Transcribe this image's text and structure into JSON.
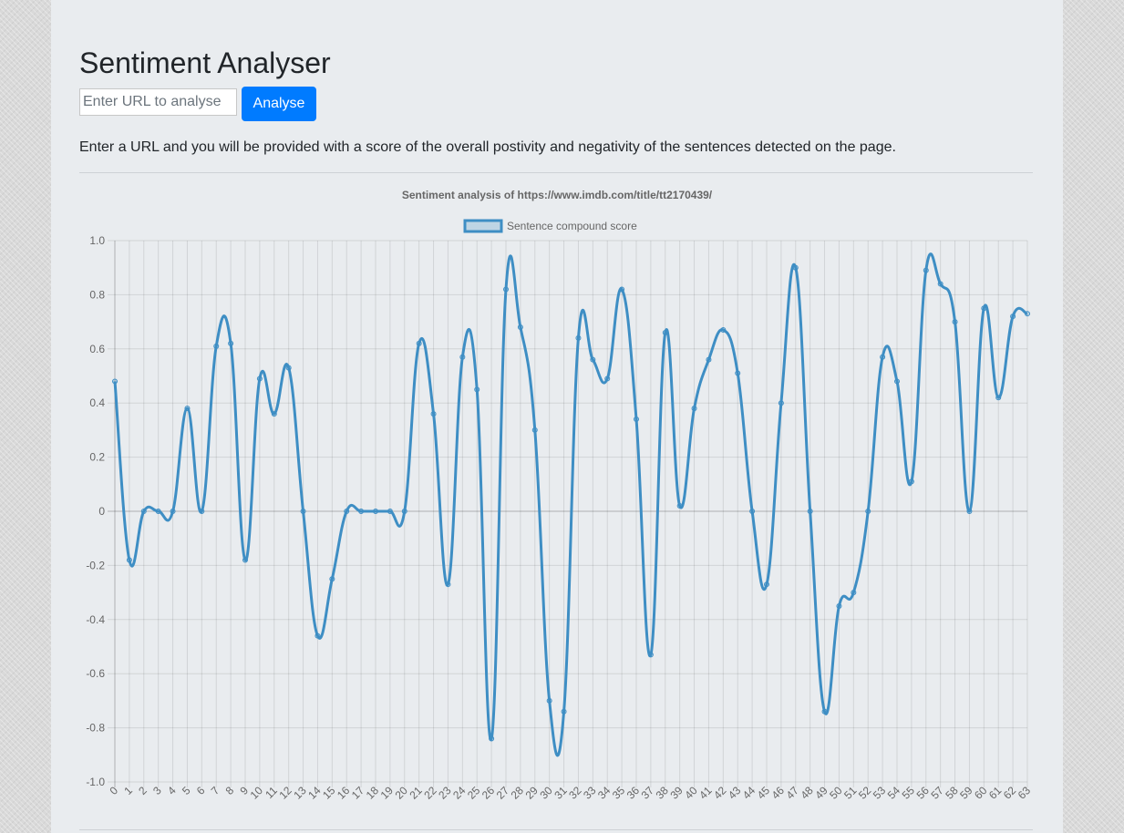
{
  "header": {
    "title": "Sentiment Analyser",
    "url_placeholder": "Enter URL to analyse",
    "analyse_label": "Analyse",
    "description": "Enter a URL and you will be provided with a score of the overall postivity and negativity of the sentences detected on the page."
  },
  "colors": {
    "accent": "#007bff",
    "series": "#3e8ec4"
  },
  "chart_data": {
    "type": "line",
    "title": "Sentiment analysis of https://www.imdb.com/title/tt2170439/",
    "legend_position": "top",
    "grid": true,
    "xlabel": "",
    "ylabel": "",
    "ylim": [
      -1.0,
      1.0
    ],
    "y_ticks": [
      "1.0",
      "0.8",
      "0.6",
      "0.4",
      "0.2",
      "0",
      "-0.2",
      "-0.4",
      "-0.6",
      "-0.8",
      "-1.0"
    ],
    "categories": [
      "0",
      "1",
      "2",
      "3",
      "4",
      "5",
      "6",
      "7",
      "8",
      "9",
      "10",
      "11",
      "12",
      "13",
      "14",
      "15",
      "16",
      "17",
      "18",
      "19",
      "20",
      "21",
      "22",
      "23",
      "24",
      "25",
      "26",
      "27",
      "28",
      "29",
      "30",
      "31",
      "32",
      "33",
      "34",
      "35",
      "36",
      "37",
      "38",
      "39",
      "40",
      "41",
      "42",
      "43",
      "44",
      "45",
      "46",
      "47",
      "48",
      "49",
      "50",
      "51",
      "52",
      "53",
      "54",
      "55",
      "56",
      "57",
      "58",
      "59",
      "60",
      "61",
      "62",
      "63"
    ],
    "series": [
      {
        "name": "Sentence compound score",
        "values": [
          0.48,
          -0.18,
          0,
          0,
          0,
          0.38,
          0,
          0.61,
          0.62,
          -0.18,
          0.49,
          0.36,
          0.53,
          0,
          -0.46,
          -0.25,
          0,
          0,
          0,
          0,
          0,
          0.62,
          0.36,
          -0.27,
          0.57,
          0.45,
          -0.84,
          0.82,
          0.68,
          0.3,
          -0.7,
          -0.74,
          0.64,
          0.56,
          0.49,
          0.82,
          0.34,
          -0.53,
          0.66,
          0.02,
          0.38,
          0.56,
          0.67,
          0.51,
          0,
          -0.27,
          0.4,
          0.9,
          0,
          -0.74,
          -0.35,
          -0.3,
          0,
          0.57,
          0.48,
          0.11,
          0.89,
          0.84,
          0.7,
          0,
          0.75,
          0.42,
          0.72,
          0.73
        ]
      }
    ]
  }
}
